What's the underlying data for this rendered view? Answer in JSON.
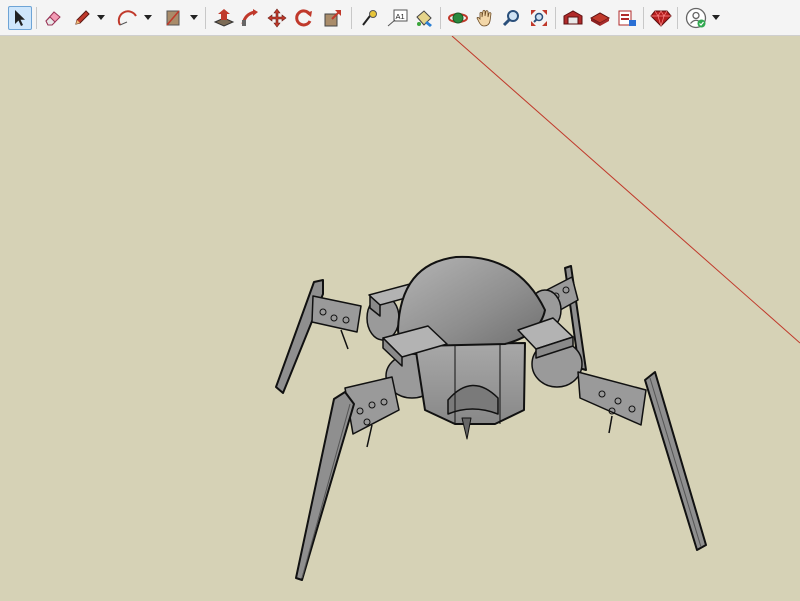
{
  "app": {
    "name": "SketchUp"
  },
  "toolbar": {
    "tools": [
      {
        "name": "select",
        "icon": "cursor-arrow-icon",
        "active": true
      },
      {
        "name": "eraser",
        "icon": "eraser-icon"
      },
      {
        "name": "pencil",
        "icon": "pencil-icon"
      },
      {
        "name": "arc",
        "icon": "arc-icon"
      },
      {
        "name": "rectangle",
        "icon": "rectangle-icon"
      },
      {
        "name": "push-pull",
        "icon": "push-pull-icon"
      },
      {
        "name": "follow-me",
        "icon": "follow-me-icon"
      },
      {
        "name": "move",
        "icon": "move-icon"
      },
      {
        "name": "rotate",
        "icon": "rotate-icon"
      },
      {
        "name": "scale",
        "icon": "scale-icon"
      },
      {
        "name": "tape-measure",
        "icon": "tape-measure-icon"
      },
      {
        "name": "text",
        "icon": "text-icon",
        "label": "A1"
      },
      {
        "name": "paint-bucket",
        "icon": "paint-bucket-icon"
      },
      {
        "name": "orbit",
        "icon": "orbit-icon"
      },
      {
        "name": "pan",
        "icon": "hand-icon"
      },
      {
        "name": "zoom",
        "icon": "magnifier-icon"
      },
      {
        "name": "zoom-extents",
        "icon": "zoom-extents-icon"
      },
      {
        "name": "warehouse",
        "icon": "warehouse-icon"
      },
      {
        "name": "share-model",
        "icon": "share-model-icon"
      },
      {
        "name": "extension-warehouse",
        "icon": "extension-warehouse-icon"
      },
      {
        "name": "ruby",
        "icon": "ruby-gem-icon"
      },
      {
        "name": "account",
        "icon": "account-icon"
      }
    ],
    "colors": {
      "background": "#f4f4f4",
      "active": "#cfe6fb"
    }
  },
  "viewport": {
    "background_color": "#d6d2b6",
    "axis_color": "#c0392b",
    "model": "spider-robot"
  }
}
